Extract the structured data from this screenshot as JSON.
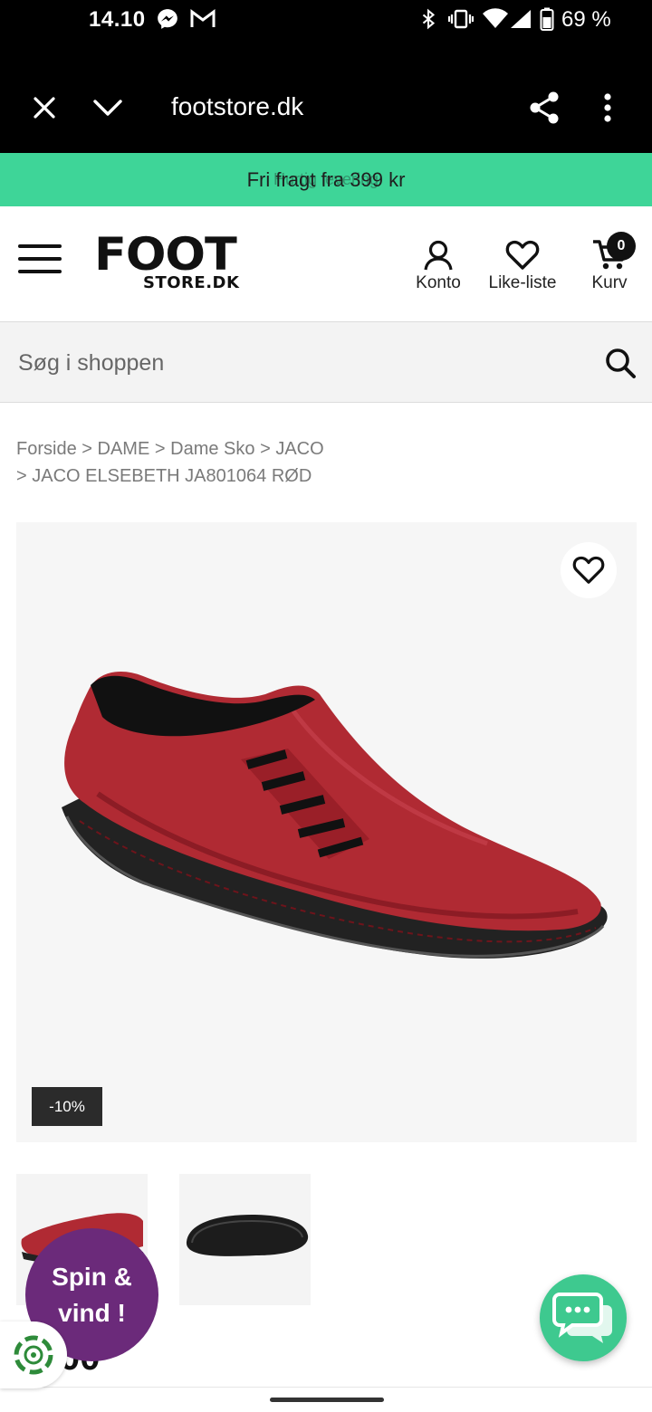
{
  "status_bar": {
    "time": "14.10",
    "battery": "69 %",
    "icons": [
      "messenger-icon",
      "gmail-icon",
      "bluetooth-icon",
      "vibrate-icon",
      "wifi-icon",
      "signal-icon",
      "battery-icon"
    ]
  },
  "browser": {
    "url": "footstore.dk",
    "icons": [
      "close-icon",
      "chevron-down-icon",
      "share-icon",
      "more-vert-icon"
    ]
  },
  "promo": {
    "text": "Fri fragt fra 399 kr",
    "ghost_text": "Hurtig levering"
  },
  "header": {
    "logo_top": "FOOT",
    "logo_bottom": "STORE.DK",
    "account_label": "Konto",
    "wishlist_label": "Like-liste",
    "cart_label": "Kurv",
    "cart_count": "0"
  },
  "search": {
    "placeholder": "Søg i shoppen"
  },
  "breadcrumb": {
    "items": [
      "Forside",
      "DAME",
      "Dame Sko",
      "JACO",
      "JACO ELSEBETH JA801064 RØD"
    ],
    "separator": ">"
  },
  "product": {
    "discount": "-10%",
    "image_color": "#b02a33"
  },
  "spin": {
    "line1": "Spin &",
    "line2": "vind !"
  },
  "partial_price": "00",
  "colors": {
    "promo_bg": "#3ed598",
    "spin_bg": "#6b2a7a",
    "chat_bg": "#3ec98f"
  }
}
